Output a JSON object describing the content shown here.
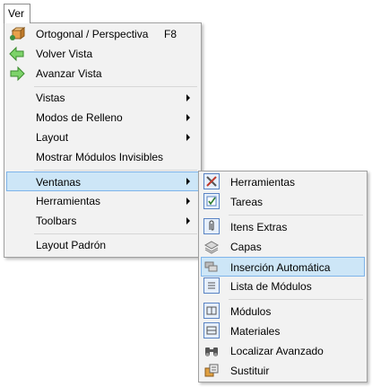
{
  "menubar": {
    "ver_label": "Ver"
  },
  "main_menu": {
    "items": [
      {
        "label": "Ortogonal / Perspectiva",
        "shortcut": "F8"
      },
      {
        "label": "Volver Vista"
      },
      {
        "label": "Avanzar Vista"
      },
      {
        "label": "Vistas"
      },
      {
        "label": "Modos de Relleno"
      },
      {
        "label": "Layout"
      },
      {
        "label": "Mostrar Módulos Invisibles"
      },
      {
        "label": "Ventanas"
      },
      {
        "label": "Herramientas"
      },
      {
        "label": "Toolbars"
      },
      {
        "label": "Layout Padrón"
      }
    ]
  },
  "sub_menu": {
    "items": [
      {
        "label": "Herramientas",
        "icon": "tools-icon"
      },
      {
        "label": "Tareas",
        "icon": "tasks-icon"
      },
      {
        "label": "Itens Extras",
        "icon": "paperclip-icon"
      },
      {
        "label": "Capas",
        "icon": "layers-icon"
      },
      {
        "label": "Inserción Automática",
        "icon": "auto-insert-icon"
      },
      {
        "label": "Lista de Módulos",
        "icon": "module-list-icon"
      },
      {
        "label": "Módulos",
        "icon": "modules-icon"
      },
      {
        "label": "Materiales",
        "icon": "materials-icon"
      },
      {
        "label": "Localizar Avanzado",
        "icon": "binoculars-icon"
      },
      {
        "label": "Sustituir",
        "icon": "replace-icon"
      }
    ]
  },
  "colors": {
    "highlight_bg": "#cde6f7",
    "highlight_border": "#7eb4ea",
    "menu_bg": "#f2f2f2"
  }
}
